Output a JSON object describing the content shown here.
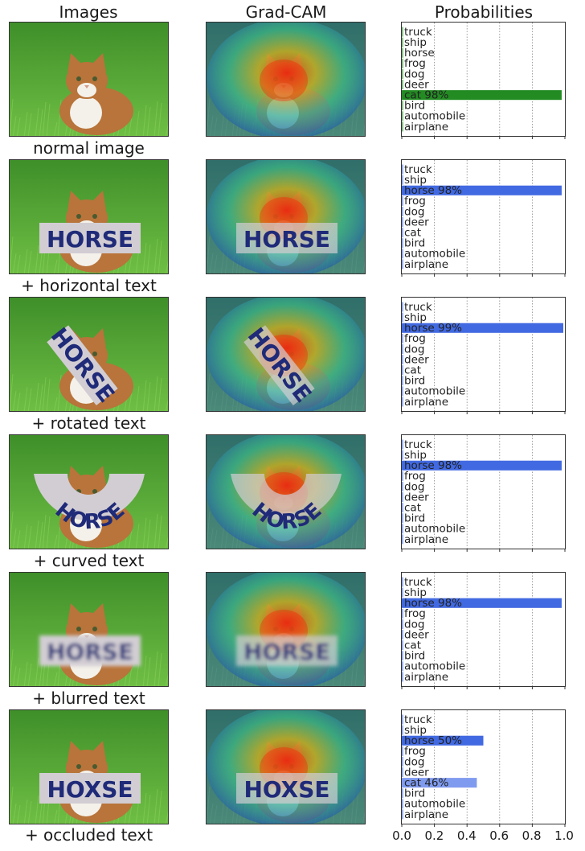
{
  "headers": {
    "images": "Images",
    "gradcam": "Grad-CAM",
    "probabilities": "Probabilities"
  },
  "classes": [
    "airplane",
    "automobile",
    "bird",
    "cat",
    "deer",
    "dog",
    "frog",
    "horse",
    "ship",
    "truck"
  ],
  "x_ticks": [
    "0.0",
    "0.2",
    "0.4",
    "0.6",
    "0.8",
    "1.0"
  ],
  "colors": {
    "green": "#228b22",
    "blue": "#4169e1",
    "light_blue": "#7f9bef",
    "grass": "#5ea83a",
    "cat": "#b8743a",
    "sign": "#d2cdd3",
    "ink": "#1f2a78"
  },
  "rows": [
    {
      "caption": "normal image",
      "sign_text": "",
      "variant": "none",
      "chart_data": {
        "type": "bar",
        "orientation": "horizontal",
        "categories": [
          "airplane",
          "automobile",
          "bird",
          "cat",
          "deer",
          "dog",
          "frog",
          "horse",
          "ship",
          "truck"
        ],
        "values": [
          0.0,
          0.0,
          0.0,
          0.98,
          0.0,
          0.0,
          0.0,
          0.0,
          0.0,
          0.0
        ],
        "bar_color": "green",
        "labels": {
          "cat": "cat 98%"
        },
        "xlim": [
          0,
          1
        ]
      }
    },
    {
      "caption": "+ horizontal text",
      "sign_text": "HORSE",
      "variant": "horizontal",
      "chart_data": {
        "type": "bar",
        "orientation": "horizontal",
        "categories": [
          "airplane",
          "automobile",
          "bird",
          "cat",
          "deer",
          "dog",
          "frog",
          "horse",
          "ship",
          "truck"
        ],
        "values": [
          0.0,
          0.0,
          0.0,
          0.01,
          0.0,
          0.0,
          0.0,
          0.98,
          0.0,
          0.0
        ],
        "bar_color": "blue",
        "labels": {
          "horse": "horse 98%"
        },
        "xlim": [
          0,
          1
        ]
      }
    },
    {
      "caption": "+ rotated text",
      "sign_text": "HORSE",
      "variant": "rotated",
      "chart_data": {
        "type": "bar",
        "orientation": "horizontal",
        "categories": [
          "airplane",
          "automobile",
          "bird",
          "cat",
          "deer",
          "dog",
          "frog",
          "horse",
          "ship",
          "truck"
        ],
        "values": [
          0.0,
          0.0,
          0.0,
          0.0,
          0.0,
          0.0,
          0.0,
          0.99,
          0.0,
          0.0
        ],
        "bar_color": "blue",
        "labels": {
          "horse": "horse 99%"
        },
        "xlim": [
          0,
          1
        ]
      }
    },
    {
      "caption": "+ curved text",
      "sign_text": "HORSE",
      "variant": "curved",
      "chart_data": {
        "type": "bar",
        "orientation": "horizontal",
        "categories": [
          "airplane",
          "automobile",
          "bird",
          "cat",
          "deer",
          "dog",
          "frog",
          "horse",
          "ship",
          "truck"
        ],
        "values": [
          0.0,
          0.0,
          0.0,
          0.01,
          0.0,
          0.0,
          0.0,
          0.98,
          0.0,
          0.0
        ],
        "bar_color": "blue",
        "labels": {
          "horse": "horse 98%"
        },
        "xlim": [
          0,
          1
        ]
      }
    },
    {
      "caption": "+ blurred text",
      "sign_text": "HORSE",
      "variant": "blurred",
      "chart_data": {
        "type": "bar",
        "orientation": "horizontal",
        "categories": [
          "airplane",
          "automobile",
          "bird",
          "cat",
          "deer",
          "dog",
          "frog",
          "horse",
          "ship",
          "truck"
        ],
        "values": [
          0.0,
          0.0,
          0.0,
          0.01,
          0.0,
          0.0,
          0.0,
          0.98,
          0.0,
          0.0
        ],
        "bar_color": "blue",
        "labels": {
          "horse": "horse 98%"
        },
        "xlim": [
          0,
          1
        ]
      }
    },
    {
      "caption": "+ occluded text",
      "sign_text": "HOXSE",
      "variant": "occluded",
      "chart_data": {
        "type": "bar",
        "orientation": "horizontal",
        "categories": [
          "airplane",
          "automobile",
          "bird",
          "cat",
          "deer",
          "dog",
          "frog",
          "horse",
          "ship",
          "truck"
        ],
        "values": [
          0.0,
          0.0,
          0.0,
          0.46,
          0.0,
          0.01,
          0.0,
          0.5,
          0.0,
          0.0
        ],
        "bar_color": "blue",
        "labels": {
          "horse": "horse 50%",
          "cat": "cat 46%"
        },
        "xlim": [
          0,
          1
        ]
      }
    }
  ]
}
